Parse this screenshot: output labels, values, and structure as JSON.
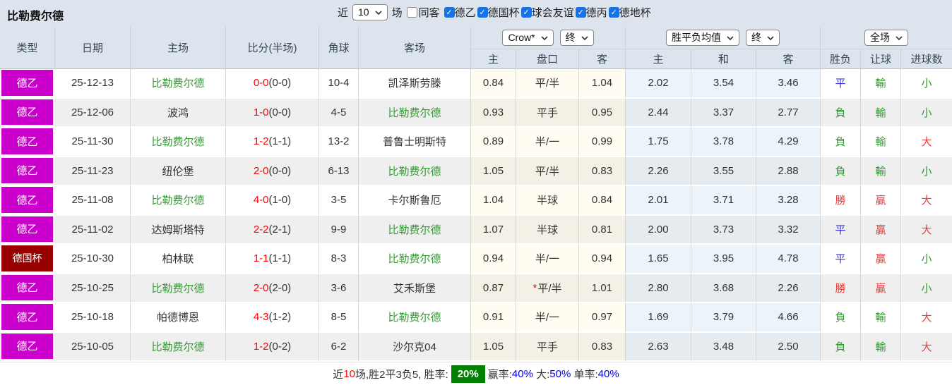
{
  "title": "比勒费尔德",
  "toolbar": {
    "near_label": "近",
    "near_value": "10",
    "games_label": "场",
    "same_opponent": {
      "label": "同客",
      "checked": false
    },
    "filters": [
      {
        "label": "德乙",
        "checked": true
      },
      {
        "label": "德国杯",
        "checked": true
      },
      {
        "label": "球会友谊",
        "checked": true
      },
      {
        "label": "德丙",
        "checked": true
      },
      {
        "label": "德地杯",
        "checked": true
      }
    ]
  },
  "table": {
    "columns": [
      "类型",
      "日期",
      "主场",
      "比分(半场)",
      "角球",
      "客场"
    ],
    "groups": [
      {
        "selects": [
          "Crow*",
          "终"
        ],
        "subcols": [
          "主",
          "盘口",
          "客"
        ]
      },
      {
        "selects": [
          "胜平负均值",
          "终"
        ],
        "subcols": [
          "主",
          "和",
          "客"
        ]
      },
      {
        "selects": [
          "全场"
        ],
        "subcols": [
          "胜负",
          "让球",
          "进球数"
        ]
      }
    ],
    "rows": [
      {
        "type": "德乙",
        "cup": false,
        "date": "25-12-13",
        "home": "比勒费尔德",
        "home_self": true,
        "score": "0-0",
        "half": "(0-0)",
        "corners": "10-4",
        "away": "凯泽斯劳滕",
        "away_self": false,
        "crow": [
          "0.84",
          "平/半",
          "1.04"
        ],
        "handicap_star": false,
        "avg": [
          "2.02",
          "3.54",
          "3.46"
        ],
        "result": {
          "text": "平",
          "color": "blue"
        },
        "handicap_bet": {
          "text": "輸",
          "color": "green"
        },
        "goals_bet": {
          "text": "小",
          "color": "green"
        }
      },
      {
        "type": "德乙",
        "cup": false,
        "date": "25-12-06",
        "home": "波鸿",
        "home_self": false,
        "score": "1-0",
        "half": "(0-0)",
        "corners": "4-5",
        "away": "比勒费尔德",
        "away_self": true,
        "crow": [
          "0.93",
          "平手",
          "0.95"
        ],
        "handicap_star": false,
        "avg": [
          "2.44",
          "3.37",
          "2.77"
        ],
        "result": {
          "text": "負",
          "color": "green"
        },
        "handicap_bet": {
          "text": "輸",
          "color": "green"
        },
        "goals_bet": {
          "text": "小",
          "color": "green"
        }
      },
      {
        "type": "德乙",
        "cup": false,
        "date": "25-11-30",
        "home": "比勒费尔德",
        "home_self": true,
        "score": "1-2",
        "half": "(1-1)",
        "corners": "13-2",
        "away": "普鲁士明斯特",
        "away_self": false,
        "crow": [
          "0.89",
          "半/一",
          "0.99"
        ],
        "handicap_star": false,
        "avg": [
          "1.75",
          "3.78",
          "4.29"
        ],
        "result": {
          "text": "負",
          "color": "green"
        },
        "handicap_bet": {
          "text": "輸",
          "color": "green"
        },
        "goals_bet": {
          "text": "大",
          "color": "red"
        }
      },
      {
        "type": "德乙",
        "cup": false,
        "date": "25-11-23",
        "home": "纽伦堡",
        "home_self": false,
        "score": "2-0",
        "half": "(0-0)",
        "corners": "6-13",
        "away": "比勒费尔德",
        "away_self": true,
        "crow": [
          "1.05",
          "平/半",
          "0.83"
        ],
        "handicap_star": false,
        "avg": [
          "2.26",
          "3.55",
          "2.88"
        ],
        "result": {
          "text": "負",
          "color": "green"
        },
        "handicap_bet": {
          "text": "輸",
          "color": "green"
        },
        "goals_bet": {
          "text": "小",
          "color": "green"
        }
      },
      {
        "type": "德乙",
        "cup": false,
        "date": "25-11-08",
        "home": "比勒费尔德",
        "home_self": true,
        "score": "4-0",
        "half": "(1-0)",
        "corners": "3-5",
        "away": "卡尔斯鲁厄",
        "away_self": false,
        "crow": [
          "1.04",
          "半球",
          "0.84"
        ],
        "handicap_star": false,
        "avg": [
          "2.01",
          "3.71",
          "3.28"
        ],
        "result": {
          "text": "勝",
          "color": "red"
        },
        "handicap_bet": {
          "text": "贏",
          "color": "red"
        },
        "goals_bet": {
          "text": "大",
          "color": "red"
        }
      },
      {
        "type": "德乙",
        "cup": false,
        "date": "25-11-02",
        "home": "达姆斯塔特",
        "home_self": false,
        "score": "2-2",
        "half": "(2-1)",
        "corners": "9-9",
        "away": "比勒费尔德",
        "away_self": true,
        "crow": [
          "1.07",
          "半球",
          "0.81"
        ],
        "handicap_star": false,
        "avg": [
          "2.00",
          "3.73",
          "3.32"
        ],
        "result": {
          "text": "平",
          "color": "blue"
        },
        "handicap_bet": {
          "text": "贏",
          "color": "red"
        },
        "goals_bet": {
          "text": "大",
          "color": "red"
        }
      },
      {
        "type": "德国杯",
        "cup": true,
        "date": "25-10-30",
        "home": "柏林联",
        "home_self": false,
        "score": "1-1",
        "half": "(1-1)",
        "corners": "8-3",
        "away": "比勒费尔德",
        "away_self": true,
        "crow": [
          "0.94",
          "半/一",
          "0.94"
        ],
        "handicap_star": false,
        "avg": [
          "1.65",
          "3.95",
          "4.78"
        ],
        "result": {
          "text": "平",
          "color": "blue"
        },
        "handicap_bet": {
          "text": "贏",
          "color": "red"
        },
        "goals_bet": {
          "text": "小",
          "color": "green"
        }
      },
      {
        "type": "德乙",
        "cup": false,
        "date": "25-10-25",
        "home": "比勒费尔德",
        "home_self": true,
        "score": "2-0",
        "half": "(2-0)",
        "corners": "3-6",
        "away": "艾禾斯堡",
        "away_self": false,
        "crow": [
          "0.87",
          "平/半",
          "1.01"
        ],
        "handicap_star": true,
        "avg": [
          "2.80",
          "3.68",
          "2.26"
        ],
        "result": {
          "text": "勝",
          "color": "red"
        },
        "handicap_bet": {
          "text": "贏",
          "color": "red"
        },
        "goals_bet": {
          "text": "小",
          "color": "green"
        }
      },
      {
        "type": "德乙",
        "cup": false,
        "date": "25-10-18",
        "home": "帕德博恩",
        "home_self": false,
        "score": "4-3",
        "half": "(1-2)",
        "corners": "8-5",
        "away": "比勒费尔德",
        "away_self": true,
        "crow": [
          "0.91",
          "半/一",
          "0.97"
        ],
        "handicap_star": false,
        "avg": [
          "1.69",
          "3.79",
          "4.66"
        ],
        "result": {
          "text": "負",
          "color": "green"
        },
        "handicap_bet": {
          "text": "輸",
          "color": "green"
        },
        "goals_bet": {
          "text": "大",
          "color": "red"
        }
      },
      {
        "type": "德乙",
        "cup": false,
        "date": "25-10-05",
        "home": "比勒费尔德",
        "home_self": true,
        "score": "1-2",
        "half": "(0-2)",
        "corners": "6-2",
        "away": "沙尔克04",
        "away_self": false,
        "crow": [
          "1.05",
          "平手",
          "0.83"
        ],
        "handicap_star": false,
        "avg": [
          "2.63",
          "3.48",
          "2.50"
        ],
        "result": {
          "text": "負",
          "color": "green"
        },
        "handicap_bet": {
          "text": "輸",
          "color": "green"
        },
        "goals_bet": {
          "text": "大",
          "color": "red"
        }
      }
    ]
  },
  "footer": {
    "segments": [
      {
        "text": "近",
        "color": "#333333"
      },
      {
        "text": "10",
        "color": "#ff0000"
      },
      {
        "text": "场,胜2平3负5, 胜率:",
        "color": "#333333"
      },
      {
        "text": "20%",
        "color": "#ffffff",
        "bg": "#008000"
      },
      {
        "text": "赢率:",
        "color": "#333333"
      },
      {
        "text": "40%",
        "color": "#0000ee"
      },
      {
        "text": " 大:",
        "color": "#333333"
      },
      {
        "text": "50%",
        "color": "#0000ee"
      },
      {
        "text": " 单率:",
        "color": "#333333"
      },
      {
        "text": "40%",
        "color": "#0000ee"
      }
    ]
  },
  "colors": {
    "league_magenta": "#cc00cc",
    "cup_dark_red": "#990000",
    "team_green": "#339933",
    "score_red": "#ff0000",
    "result_blue": "#3434d4",
    "result_green": "#339933",
    "result_red": "#ee3b3b",
    "win_rate_bg": "#008000",
    "stat_blue": "#0000ee",
    "header_bg": "#dce4ee"
  }
}
